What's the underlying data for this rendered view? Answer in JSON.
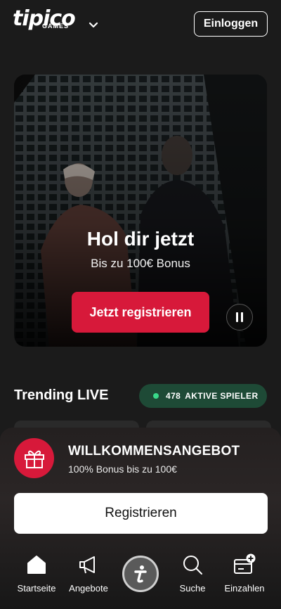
{
  "header": {
    "logo_text": "tipico",
    "logo_sub": "GAMES",
    "login_label": "Einloggen"
  },
  "hero": {
    "title": "Hol dir jetzt",
    "subtitle": "Bis zu 100€ Bonus",
    "cta_label": "Jetzt registrieren"
  },
  "trending": {
    "title": "Trending LIVE",
    "live_count": "478",
    "live_label": "AKTIVE SPIELER"
  },
  "welcome": {
    "title": "WILLKOMMENSANGEBOT",
    "subtitle": "100% Bonus bis zu 100€",
    "button_label": "Registrieren"
  },
  "nav": {
    "items": [
      {
        "label": "Startseite",
        "icon": "home-icon"
      },
      {
        "label": "Angebote",
        "icon": "megaphone-icon"
      },
      {
        "label": "",
        "icon": "tipico-t-icon"
      },
      {
        "label": "Suche",
        "icon": "search-icon"
      },
      {
        "label": "Einzahlen",
        "icon": "wallet-plus-icon"
      }
    ]
  },
  "colors": {
    "background": "#1b1b1b",
    "accent_red": "#d7193a",
    "live_green": "#39d98a",
    "badge_green": "#1e4a36"
  }
}
